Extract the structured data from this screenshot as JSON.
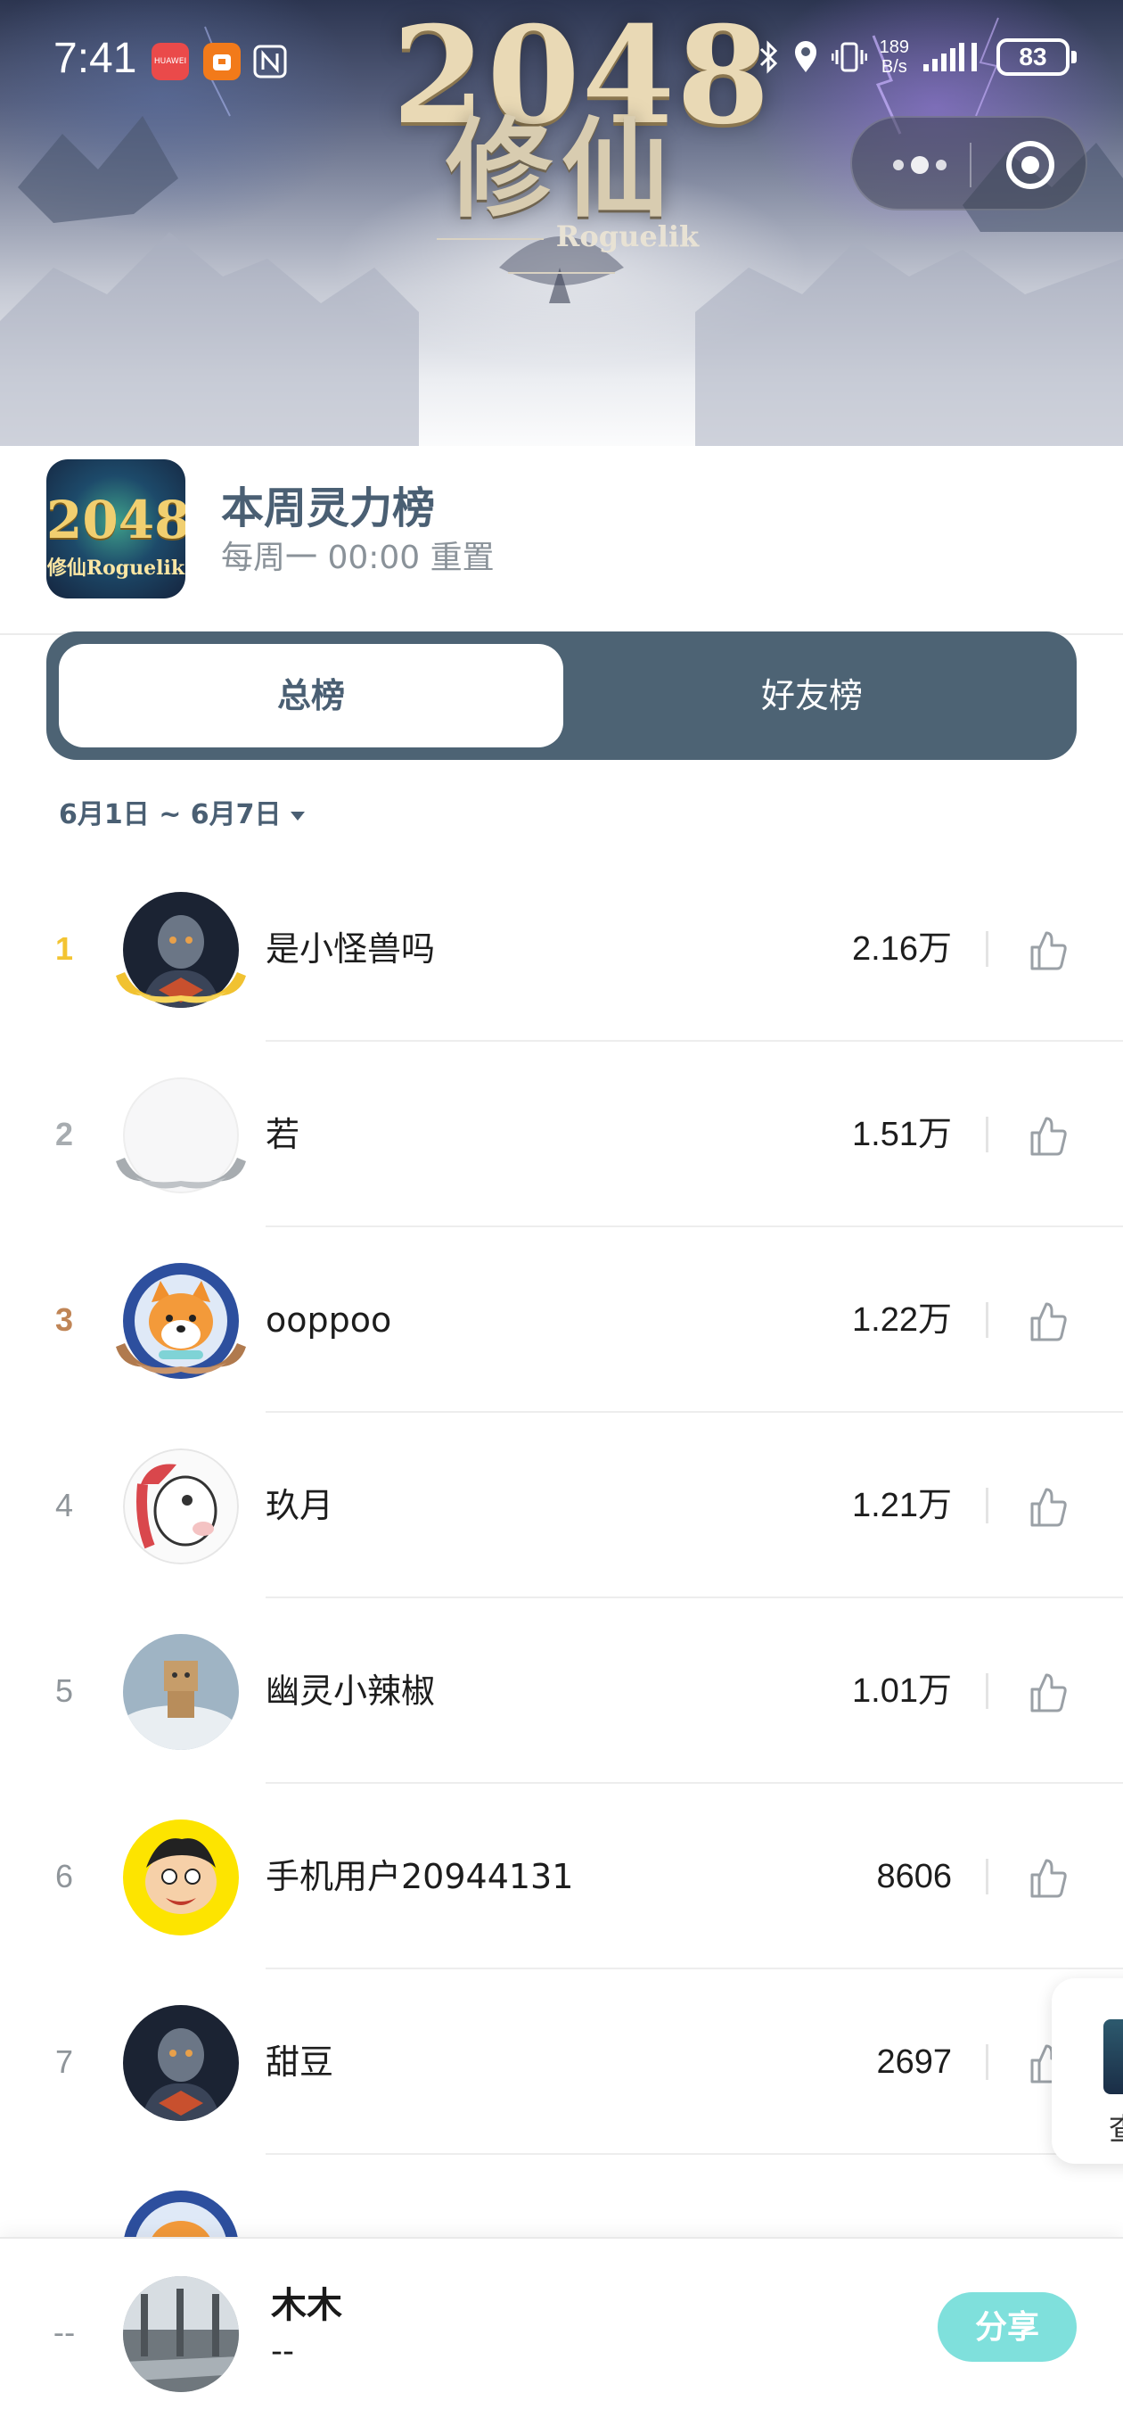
{
  "status_bar": {
    "time": "7:41",
    "app_icons": [
      "huawei-store-icon",
      "orange-app-icon",
      "nfc-icon"
    ],
    "app_badge": "HUAWEI",
    "net_speed_value": "189",
    "net_speed_unit": "B/s",
    "battery": "83"
  },
  "banner": {
    "logo_number": "2048",
    "logo_title": "修仙",
    "logo_subtitle": "Roguelik"
  },
  "header": {
    "game_icon_number": "2048",
    "game_icon_text": "修仙Roguelik",
    "title": "本周灵力榜",
    "subtitle": "每周一 00:00 重置"
  },
  "tabs": [
    {
      "label": "总榜",
      "active": true
    },
    {
      "label": "好友榜",
      "active": false
    }
  ],
  "date_range": "6月1日 ~ 6月7日",
  "leaderboard": [
    {
      "rank": "1",
      "name": "是小怪兽吗",
      "score": "2.16万",
      "avatar": "armored-warrior",
      "medal": "gold"
    },
    {
      "rank": "2",
      "name": "若",
      "score": "1.51万",
      "avatar": "blank-white",
      "medal": "silver"
    },
    {
      "rank": "3",
      "name": "ooppoo",
      "score": "1.22万",
      "avatar": "shiba-dog",
      "medal": "bronze"
    },
    {
      "rank": "4",
      "name": "玖月",
      "score": "1.21万",
      "avatar": "cartoon-horse",
      "medal": "none"
    },
    {
      "rank": "5",
      "name": "幽灵小辣椒",
      "score": "1.01万",
      "avatar": "box-robot",
      "medal": "none"
    },
    {
      "rank": "6",
      "name": "手机用户20944131",
      "score": "8606",
      "avatar": "cartoon-kid",
      "medal": "none"
    },
    {
      "rank": "7",
      "name": "甜豆",
      "score": "2697",
      "avatar": "armored-warrior",
      "medal": "none"
    }
  ],
  "floating_card": {
    "text": "查"
  },
  "my_rank": {
    "rank": "--",
    "name": "木木",
    "score": "--",
    "share_label": "分享"
  },
  "colors": {
    "accent": "#4d6374",
    "title": "#4a5f73",
    "gold": "#f3c432",
    "silver": "#a7acb0",
    "bronze": "#c08556",
    "share": "#7fe0dc"
  }
}
